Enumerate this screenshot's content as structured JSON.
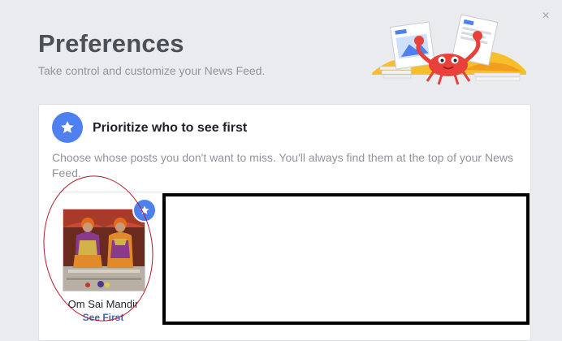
{
  "dialog": {
    "close_symbol": "×",
    "title": "Preferences",
    "subtitle": "Take control and customize your News Feed."
  },
  "section": {
    "icon": "star-icon",
    "title": "Prioritize who to see first",
    "description": "Choose whose posts you don't want to miss. You'll always find them at the top of your News Feed."
  },
  "pages": [
    {
      "name": "Om Sai Mandir",
      "action": "See First",
      "selected": true
    }
  ],
  "colors": {
    "accent": "#4e80f0",
    "link": "#4267b2",
    "annotation": "#b4182c",
    "redaction": "#000000"
  }
}
